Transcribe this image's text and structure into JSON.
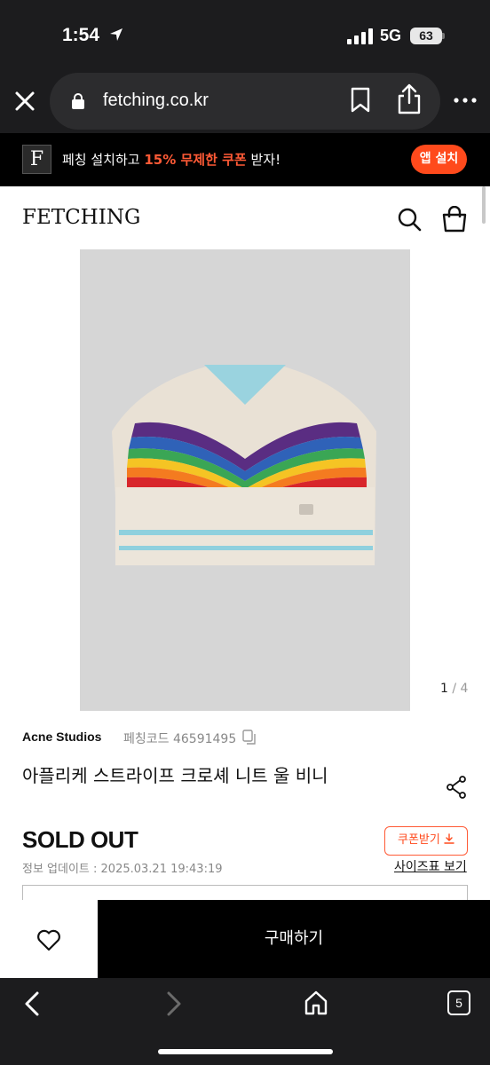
{
  "status_bar": {
    "time": "1:54",
    "network": "5G",
    "battery": "63"
  },
  "browser": {
    "url": "fetching.co.kr",
    "tab_count": "5"
  },
  "app_banner": {
    "text_before": "페칭 설치하고 ",
    "text_highlight": "15% 무제한 쿠폰",
    "text_after": " 받자!",
    "logo_letter": "F",
    "install_label": "앱 설치",
    "accent_color": "#ff4a1c"
  },
  "header": {
    "brand": "FETCHING"
  },
  "gallery": {
    "current": "1",
    "separator": " / ",
    "total": "4"
  },
  "product": {
    "brand": "Acne Studios",
    "code": "페칭코드 46591495",
    "title": "아플리케 스트라이프 크로셰 니트 울 비니",
    "status": "SOLD OUT",
    "updated": "정보 업데이트 : 2025.03.21 19:43:19",
    "coupon_label": "쿠폰받기",
    "size_chart_label": "사이즈표 보기"
  },
  "bottom_bar": {
    "buy_label": "구매하기"
  },
  "icons": [
    "location-arrow-icon",
    "signal-icon",
    "close-icon",
    "lock-icon",
    "bookmark-icon",
    "share-icon",
    "more-icon",
    "search-icon",
    "shopping-bag-icon",
    "copy-icon",
    "share-nodes-icon",
    "download-icon",
    "heart-icon",
    "back-icon",
    "forward-icon",
    "home-icon"
  ]
}
